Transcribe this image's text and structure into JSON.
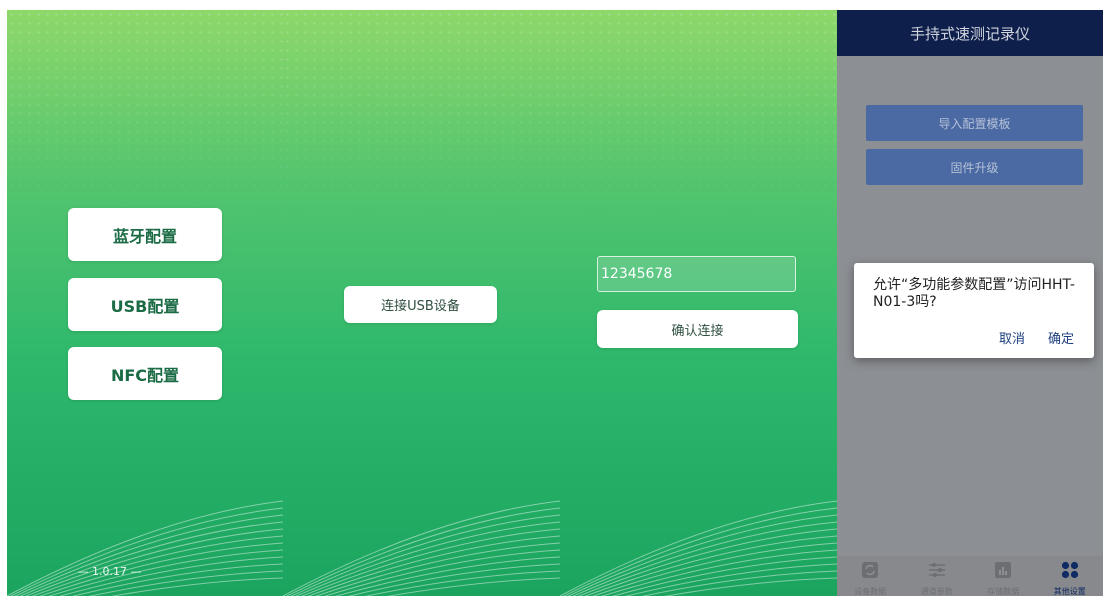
{
  "screen1": {
    "bluetooth_label": "蓝牙配置",
    "usb_label": "USB配置",
    "nfc_label": "NFC配置",
    "version": "— 1.0.17 —"
  },
  "screen2": {
    "connect_usb_label": "连接USB设备"
  },
  "screen3": {
    "password_value": "12345678",
    "confirm_label": "确认连接"
  },
  "screen4": {
    "title": "手持式速测记录仪",
    "import_template_label": "导入配置模板",
    "firmware_upgrade_label": "固件升级",
    "dialog": {
      "message": "允许“多功能参数配置”访问HHT-N01-3吗?",
      "cancel_label": "取消",
      "ok_label": "确定"
    },
    "tabs": [
      {
        "label": "设备数据",
        "icon": "refresh-icon"
      },
      {
        "label": "通道参数",
        "icon": "sliders-icon"
      },
      {
        "label": "存储数据",
        "icon": "chart-icon"
      },
      {
        "label": "其他设置",
        "icon": "grid-dots-icon"
      }
    ],
    "active_tab": "其他设置"
  },
  "colors": {
    "gradient_top": "#8ed86a",
    "gradient_bottom": "#1aa45e",
    "nav_dark": "#0f1f4c",
    "option_blue": "#4b6aa3",
    "dialog_action": "#1d3f7f"
  }
}
